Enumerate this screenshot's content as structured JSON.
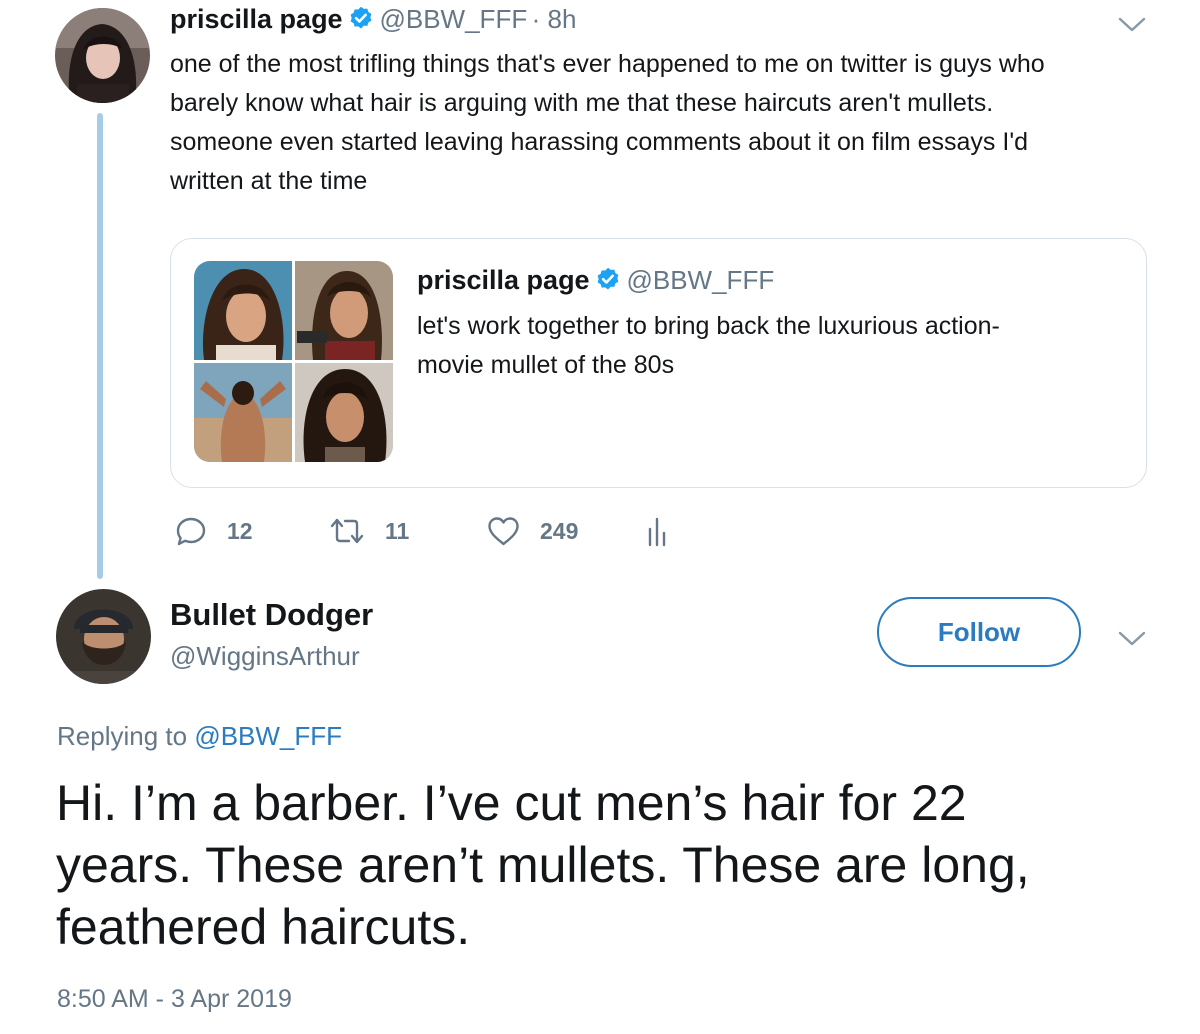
{
  "parent_tweet": {
    "name": "priscilla page",
    "handle": "@BBW_FFF",
    "time": "· 8h",
    "text_lines": [
      "one of the most trifling things that's ever happened to me on twitter is guys who",
      "barely know what hair is arguing with me that these haircuts aren't mullets.",
      "someone even started leaving harassing comments about it on film essays I'd",
      "written at the time"
    ],
    "quote": {
      "name": "priscilla page",
      "handle": "@BBW_FFF",
      "text_lines": [
        "let's work together to bring back the luxurious action-",
        "movie mullet of the 80s"
      ]
    },
    "actions": {
      "replies": "12",
      "retweets": "11",
      "likes": "249"
    }
  },
  "main_tweet": {
    "name": "Bullet Dodger",
    "handle": "@WigginsArthur",
    "follow_label": "Follow",
    "replying_prefix": "Replying to",
    "replying_to": "@BBW_FFF",
    "text_lines": [
      "Hi. I’m a barber. I’ve cut men’s hair for 22",
      "years. These aren’t mullets. These are long,",
      "feathered haircuts."
    ],
    "timestamp": "8:50 AM - 3 Apr 2019"
  },
  "icons": {
    "verified": "verified-badge-icon",
    "menu": "chevron-down-icon",
    "reply": "reply-icon",
    "retweet": "retweet-icon",
    "like": "heart-icon",
    "analytics": "analytics-icon"
  },
  "colors": {
    "accent": "#2a7bc0",
    "verified": "#1da1f2",
    "muted": "#657786",
    "thread_line": "#a5cde9"
  }
}
